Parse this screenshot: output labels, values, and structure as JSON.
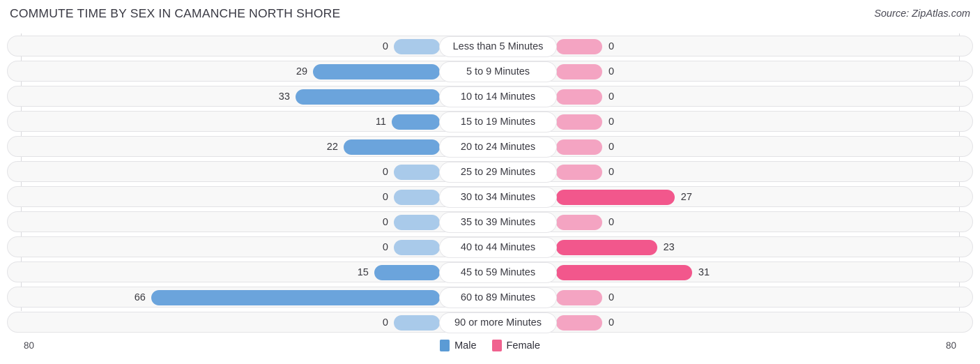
{
  "header": {
    "title": "COMMUTE TIME BY SEX IN CAMANCHE NORTH SHORE",
    "source": "Source: ZipAtlas.com"
  },
  "legend": {
    "male_label": "Male",
    "female_label": "Female",
    "male_color": "#5B9BD5",
    "female_color": "#F0628F"
  },
  "axis": {
    "left_label": "80",
    "right_label": "80",
    "max": 80
  },
  "colors": {
    "male_strong": "#6BA4DC",
    "male_light": "#A9CAEA",
    "female_strong": "#F2578C",
    "female_light": "#F4A4C2",
    "row_bg": "#f8f8f8",
    "row_border": "#e3e3e6",
    "pill_bg": "#ffffff",
    "title": "#3a3a44"
  },
  "chart_data": {
    "type": "bar",
    "subtype": "diverging-horizontal",
    "title": "COMMUTE TIME BY SEX IN CAMANCHE NORTH SHORE",
    "xlabel": "",
    "ylabel": "",
    "xlim": [
      80,
      80
    ],
    "grid": true,
    "legend_position": "bottom-center",
    "categories": [
      "Less than 5 Minutes",
      "5 to 9 Minutes",
      "10 to 14 Minutes",
      "15 to 19 Minutes",
      "20 to 24 Minutes",
      "25 to 29 Minutes",
      "30 to 34 Minutes",
      "35 to 39 Minutes",
      "40 to 44 Minutes",
      "45 to 59 Minutes",
      "60 to 89 Minutes",
      "90 or more Minutes"
    ],
    "series": [
      {
        "name": "Male",
        "direction": "left",
        "color": "#5B9BD5",
        "values": [
          0,
          29,
          33,
          11,
          22,
          0,
          0,
          0,
          0,
          15,
          66,
          0
        ]
      },
      {
        "name": "Female",
        "direction": "right",
        "color": "#F0628F",
        "values": [
          0,
          0,
          0,
          0,
          0,
          0,
          27,
          0,
          23,
          31,
          0,
          0
        ]
      }
    ]
  },
  "rows": [
    {
      "category": "Less than 5 Minutes",
      "male": "0",
      "female": "0"
    },
    {
      "category": "5 to 9 Minutes",
      "male": "29",
      "female": "0"
    },
    {
      "category": "10 to 14 Minutes",
      "male": "33",
      "female": "0"
    },
    {
      "category": "15 to 19 Minutes",
      "male": "11",
      "female": "0"
    },
    {
      "category": "20 to 24 Minutes",
      "male": "22",
      "female": "0"
    },
    {
      "category": "25 to 29 Minutes",
      "male": "0",
      "female": "0"
    },
    {
      "category": "30 to 34 Minutes",
      "male": "0",
      "female": "27"
    },
    {
      "category": "35 to 39 Minutes",
      "male": "0",
      "female": "0"
    },
    {
      "category": "40 to 44 Minutes",
      "male": "0",
      "female": "23"
    },
    {
      "category": "45 to 59 Minutes",
      "male": "15",
      "female": "31"
    },
    {
      "category": "60 to 89 Minutes",
      "male": "66",
      "female": "0"
    },
    {
      "category": "90 or more Minutes",
      "male": "0",
      "female": "0"
    }
  ]
}
